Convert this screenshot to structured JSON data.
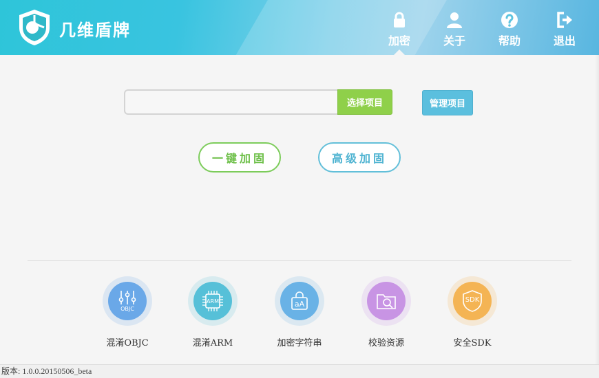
{
  "app": {
    "title": "几维盾牌"
  },
  "nav": [
    {
      "label": "加密",
      "icon": "lock-icon"
    },
    {
      "label": "关于",
      "icon": "user-icon"
    },
    {
      "label": "帮助",
      "icon": "help-icon"
    },
    {
      "label": "退出",
      "icon": "logout-icon"
    }
  ],
  "project": {
    "input_value": "",
    "select_label": "选择项目",
    "manage_label": "管理项目"
  },
  "actions": {
    "one_click": "一键加固",
    "advanced": "高级加固"
  },
  "features": [
    {
      "label": "混淆OBJC",
      "badge": "OBJC",
      "icon": "sliders-icon",
      "color": "#6aa8e8"
    },
    {
      "label": "混淆ARM",
      "badge": "ARM",
      "icon": "chip-icon",
      "color": "#56c0d8"
    },
    {
      "label": "加密字符串",
      "badge": "aA",
      "icon": "text-lock-icon",
      "color": "#69b2e6"
    },
    {
      "label": "校验资源",
      "badge": "",
      "icon": "folder-search-icon",
      "color": "#c894e4"
    },
    {
      "label": "安全SDK",
      "badge": "SDK",
      "icon": "shield-sdk-icon",
      "color": "#f4b454"
    }
  ],
  "status": {
    "version": "版本: 1.0.0.20150506_beta"
  },
  "colors": {
    "accent_green": "#8fd04a",
    "accent_blue": "#5bbfde"
  }
}
